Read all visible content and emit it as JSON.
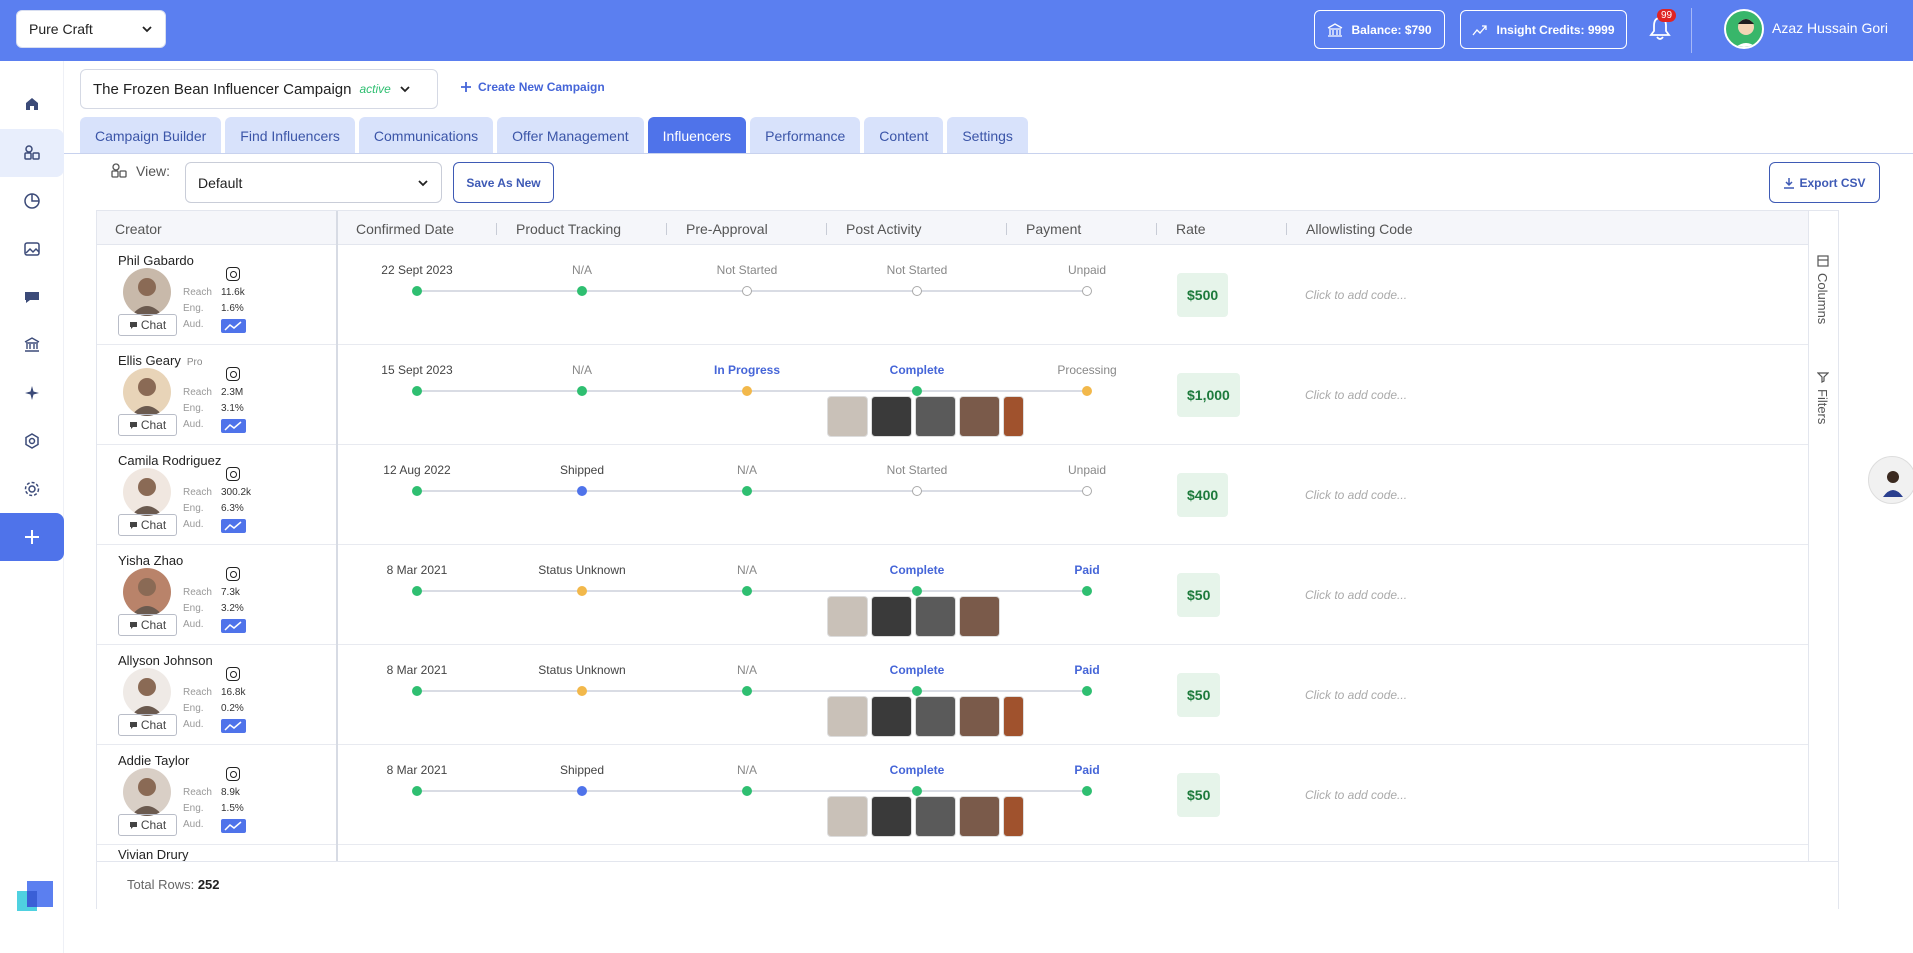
{
  "topbar": {
    "workspace": "Pure Craft",
    "balance": "Balance: $790",
    "insight_credits": "Insight Credits: 9999",
    "notifications_count": "99",
    "user_name": "Azaz Hussain Gori",
    "accent": "#5b7ff0"
  },
  "campaign": {
    "name": "The Frozen Bean Influencer Campaign",
    "status": "active",
    "create_label": "Create New Campaign"
  },
  "tabs": [
    "Campaign Builder",
    "Find Influencers",
    "Communications",
    "Offer Management",
    "Influencers",
    "Performance",
    "Content",
    "Settings"
  ],
  "active_tab": "Influencers",
  "view": {
    "label": "View:",
    "selected": "Default",
    "save_as_new": "Save As New",
    "export": "Export CSV"
  },
  "table": {
    "headers": [
      "Creator",
      "Confirmed Date",
      "Product Tracking",
      "Pre-Approval",
      "Post Activity",
      "Payment",
      "Rate",
      "Allowlisting Code"
    ],
    "stat_labels": [
      "Reach",
      "Eng.",
      "Aud."
    ],
    "chat_label": "Chat",
    "allow_placeholder": "Click to add code...",
    "rail": {
      "columns": "Columns",
      "filters": "Filters"
    },
    "rows": [
      {
        "name": "Phil Gabardo",
        "pro": "",
        "reach": "11.6k",
        "eng": "1.6%",
        "confirmed": "22 Sept 2023",
        "tracking": "N/A",
        "pre_approval": "Not Started",
        "post_activity": "Not Started",
        "payment": "Unpaid",
        "rate": "$500",
        "thumbs": 0
      },
      {
        "name": "Ellis Geary",
        "pro": "Pro",
        "reach": "2.3M",
        "eng": "3.1%",
        "confirmed": "15 Sept 2023",
        "tracking": "N/A",
        "pre_approval": "In Progress",
        "post_activity": "Complete",
        "payment": "Processing",
        "rate": "$1,000",
        "thumbs": 5
      },
      {
        "name": "Camila Rodriguez",
        "pro": "",
        "reach": "300.2k",
        "eng": "6.3%",
        "confirmed": "12 Aug 2022",
        "tracking": "Shipped",
        "pre_approval": "N/A",
        "post_activity": "Not Started",
        "payment": "Unpaid",
        "rate": "$400",
        "thumbs": 0
      },
      {
        "name": "Yisha Zhao",
        "pro": "",
        "reach": "7.3k",
        "eng": "3.2%",
        "confirmed": "8 Mar 2021",
        "tracking": "Status Unknown",
        "pre_approval": "N/A",
        "post_activity": "Complete",
        "payment": "Paid",
        "rate": "$50",
        "thumbs": 4
      },
      {
        "name": "Allyson Johnson",
        "pro": "",
        "reach": "16.8k",
        "eng": "0.2%",
        "confirmed": "8 Mar 2021",
        "tracking": "Status Unknown",
        "pre_approval": "N/A",
        "post_activity": "Complete",
        "payment": "Paid",
        "rate": "$50",
        "thumbs": 5
      },
      {
        "name": "Addie Taylor",
        "pro": "",
        "reach": "8.9k",
        "eng": "1.5%",
        "confirmed": "8 Mar 2021",
        "tracking": "Shipped",
        "pre_approval": "N/A",
        "post_activity": "Complete",
        "payment": "Paid",
        "rate": "$50",
        "thumbs": 5
      }
    ],
    "partial_row_name": "Vivian Drury",
    "total_label": "Total Rows:",
    "total_value": "252"
  }
}
